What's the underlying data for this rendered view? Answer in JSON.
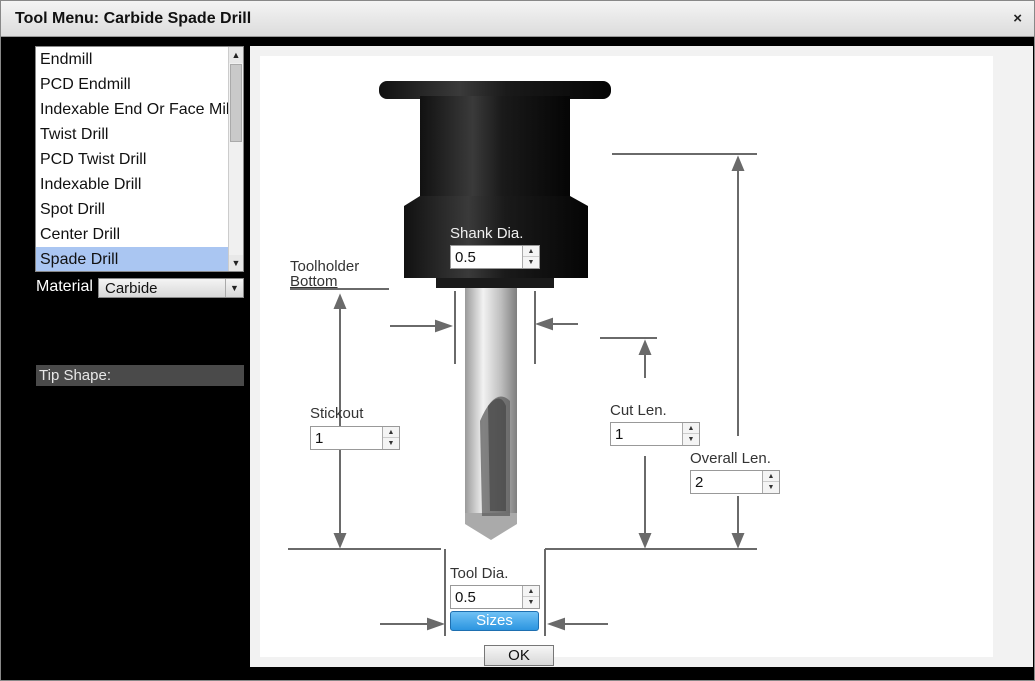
{
  "window": {
    "title": "Tool Menu: Carbide Spade Drill",
    "close_label": "×"
  },
  "tool_list": {
    "items": [
      {
        "label": "Endmill",
        "selected": false
      },
      {
        "label": "PCD Endmill",
        "selected": false
      },
      {
        "label": "Indexable End Or Face Mill",
        "selected": false
      },
      {
        "label": "Twist Drill",
        "selected": false
      },
      {
        "label": "PCD Twist Drill",
        "selected": false
      },
      {
        "label": "Indexable Drill",
        "selected": false
      },
      {
        "label": "Spot Drill",
        "selected": false
      },
      {
        "label": "Center Drill",
        "selected": false
      },
      {
        "label": "Spade Drill",
        "selected": true
      }
    ]
  },
  "material": {
    "label": "Material",
    "value": "Carbide"
  },
  "tip_shape": {
    "label": "Tip Shape:"
  },
  "diagram": {
    "shank_dia": {
      "label": "Shank Dia.",
      "value": "0.5"
    },
    "toolholder_bottom": {
      "line1": "Toolholder",
      "line2": "Bottom"
    },
    "stickout": {
      "label": "Stickout",
      "value": "1"
    },
    "cut_len": {
      "label": "Cut Len.",
      "value": "1"
    },
    "overall_len": {
      "label": "Overall Len.",
      "value": "2"
    },
    "tool_dia": {
      "label": "Tool Dia.",
      "value": "0.5"
    },
    "sizes_label": "Sizes"
  },
  "ok_label": "OK",
  "colors": {
    "selected_item": "#aac6f2",
    "sizes_button": "#2c95e0",
    "dimension_lines": "#6a6a6a"
  }
}
